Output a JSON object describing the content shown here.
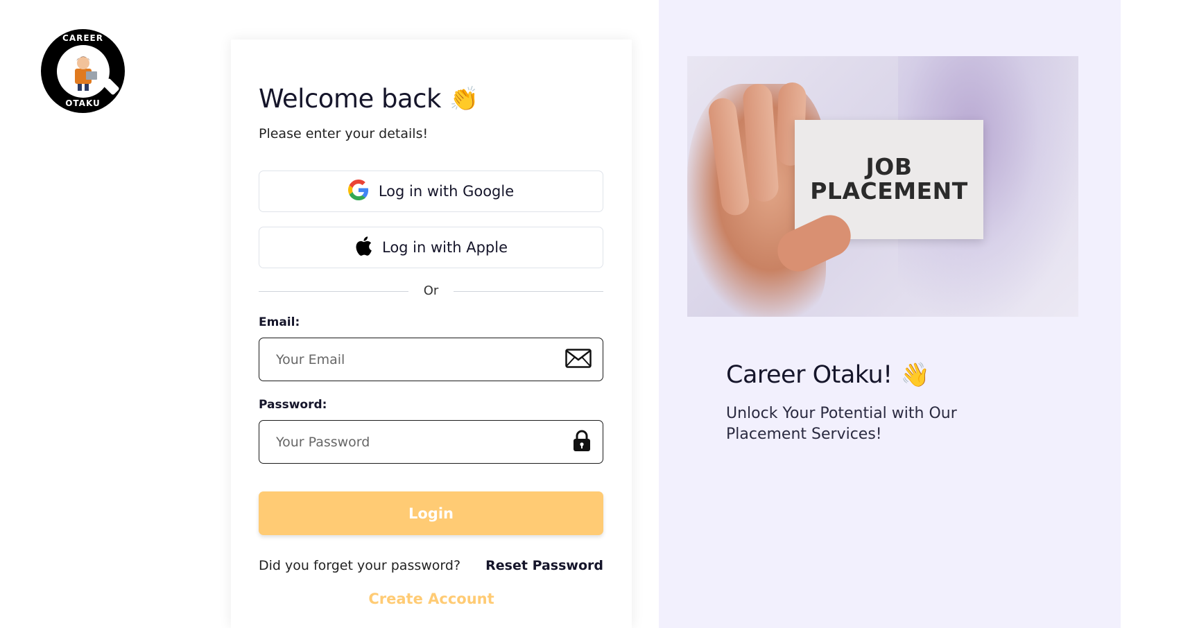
{
  "logo": {
    "text_top": "CAREER",
    "text_bottom": "OTAKU"
  },
  "login": {
    "heading": "Welcome back",
    "heading_emoji": "👏",
    "subheading": "Please enter your details!",
    "google_label": "Log in with Google",
    "apple_label": "Log in with Apple",
    "divider_text": "Or",
    "email_label": "Email:",
    "email_placeholder": "Your Email",
    "password_label": "Password:",
    "password_placeholder": "Your Password",
    "login_button": "Login",
    "forgot_text": "Did you forget your password?",
    "reset_link": "Reset Password",
    "create_account": "Create Account"
  },
  "promo": {
    "image_line1": "JOB",
    "image_line2": "PLACEMENT",
    "title": "Career Otaku!",
    "title_emoji": "👋",
    "subtitle": "Unlock Your Potential with Our Placement Services!"
  },
  "colors": {
    "accent": "#ffcb74",
    "panel_bg": "#f2f0fd",
    "text_dark": "#15152a"
  },
  "icons": {
    "google": "google-icon",
    "apple": "apple-icon",
    "email": "envelope-icon",
    "password": "lock-icon"
  }
}
